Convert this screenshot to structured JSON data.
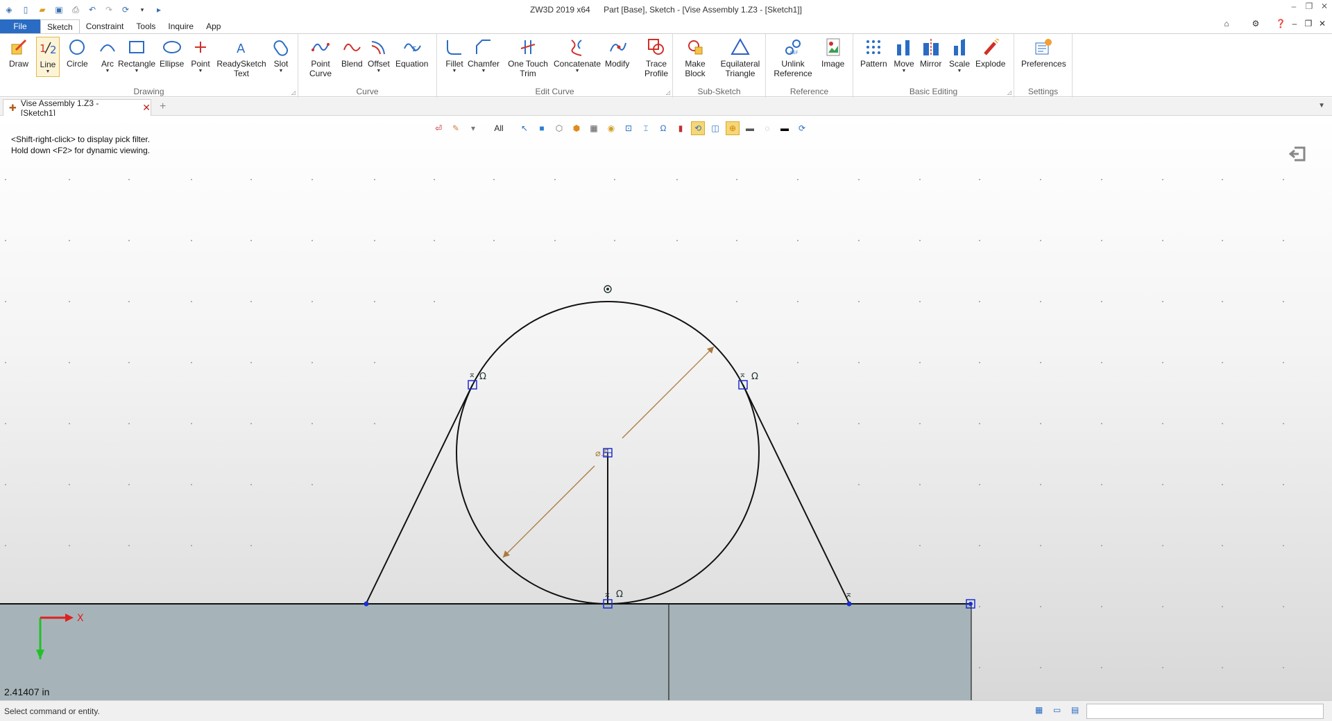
{
  "title": {
    "app": "ZW3D 2019  x64",
    "context": "Part [Base],  Sketch - [Vise Assembly 1.Z3 - [Sketch1]]"
  },
  "tabs": [
    "File",
    "Sketch",
    "Constraint",
    "Tools",
    "Inquire",
    "App"
  ],
  "ribbon": {
    "groups": [
      {
        "label": "Drawing",
        "buttons": [
          "Draw",
          "Line",
          "Circle",
          "Arc",
          "Rectangle",
          "Ellipse",
          "Point",
          "ReadySketch Text",
          "Slot"
        ]
      },
      {
        "label": "Curve",
        "buttons": [
          "Point Curve",
          "Blend",
          "Offset",
          "Equation"
        ]
      },
      {
        "label": "Edit Curve",
        "buttons": [
          "Fillet",
          "Chamfer",
          "One Touch Trim",
          "Concatenate",
          "Modify",
          "Trace Profile"
        ]
      },
      {
        "label": "Sub-Sketch",
        "buttons": [
          "Make Block",
          "Equilateral Triangle"
        ]
      },
      {
        "label": "Reference",
        "buttons": [
          "Unlink Reference",
          "Image"
        ]
      },
      {
        "label": "Basic Editing",
        "buttons": [
          "Pattern",
          "Move",
          "Mirror",
          "Scale",
          "Explode"
        ]
      },
      {
        "label": "Settings",
        "buttons": [
          "Preferences"
        ]
      }
    ],
    "selected_button": "Line"
  },
  "document_tab": {
    "label": "Vise Assembly 1.Z3 - [Sketch1]"
  },
  "viewport": {
    "hints": [
      "<Shift-right-click> to display pick filter.",
      "Hold down <F2> for dynamic viewing."
    ],
    "filter_label": "All",
    "dimension_label": "⌀.5",
    "axis_label": "X",
    "coordinate_readout": "2.41407 in",
    "colors": {
      "geometry": "#111111",
      "dimension": "#a87a3c",
      "constraint_marker": "#1a2fd0"
    }
  },
  "status": {
    "message": "Select command or entity.",
    "input_value": ""
  }
}
